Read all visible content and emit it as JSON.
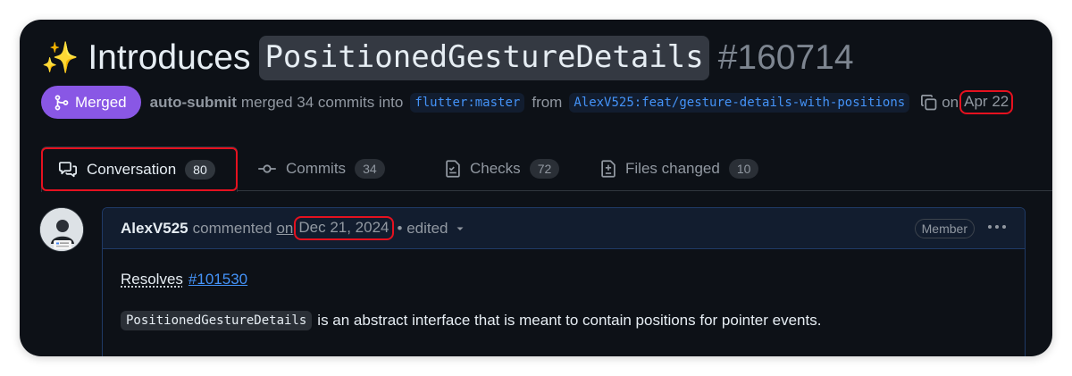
{
  "title": {
    "emoji": "✨",
    "text": "Introduces",
    "code": "PositionedGestureDetails",
    "number": "#160714"
  },
  "meta": {
    "state": "Merged",
    "author": "auto-submit",
    "merged_text": "merged 34 commits into",
    "base_branch": "flutter:master",
    "from_text": "from",
    "head_branch": "AlexV525:feat/gesture-details-with-positions",
    "on_text": "on",
    "date": "Apr 22",
    "icons": [
      "git-merge-icon",
      "copy-icon"
    ]
  },
  "tabs": [
    {
      "label": "Conversation",
      "count": "80",
      "icon": "comment-discussion-icon",
      "active": true
    },
    {
      "label": "Commits",
      "count": "34",
      "icon": "git-commit-icon",
      "active": false
    },
    {
      "label": "Checks",
      "count": "72",
      "icon": "checklist-icon",
      "active": false
    },
    {
      "label": "Files changed",
      "count": "10",
      "icon": "file-diff-icon",
      "active": false
    }
  ],
  "comment": {
    "author": "AlexV525",
    "verb": "commented",
    "on": "on",
    "date": "Dec 21, 2024",
    "edited": "• edited",
    "badge": "Member",
    "body": {
      "resolves": "Resolves",
      "issue": "#101530",
      "code": "PositionedGestureDetails",
      "text": "is an abstract interface that is meant to contain positions for pointer events."
    }
  },
  "colors": {
    "background": "#0d1117",
    "merged": "#8957e5",
    "link": "#4493f8",
    "highlight": "#e5111f"
  }
}
